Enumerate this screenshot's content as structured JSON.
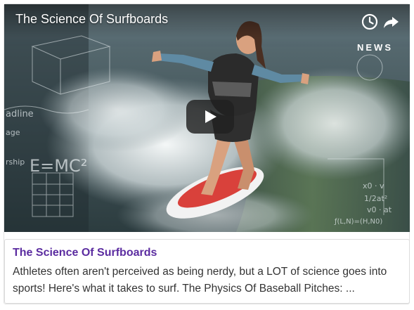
{
  "video": {
    "title": "The Science Of Surfboards",
    "brand_badge": "NEWS",
    "controls": {
      "watch_later_icon": "clock-icon",
      "share_icon": "share-arrow-icon",
      "play_icon": "play-icon"
    },
    "overlay_formulas": [
      "E=MC²",
      "x0 · v",
      "1/2at²",
      "v0 · at"
    ]
  },
  "caption": {
    "title": "The Science Of Surfboards",
    "description": "Athletes often aren't perceived as being nerdy, but a LOT of science goes into sports! Here's what it takes to surf. The Physics Of Baseball Pitches: ..."
  },
  "colors": {
    "caption_title": "#5b2ca0",
    "description_text": "#333333",
    "play_button_bg": "#212121"
  }
}
